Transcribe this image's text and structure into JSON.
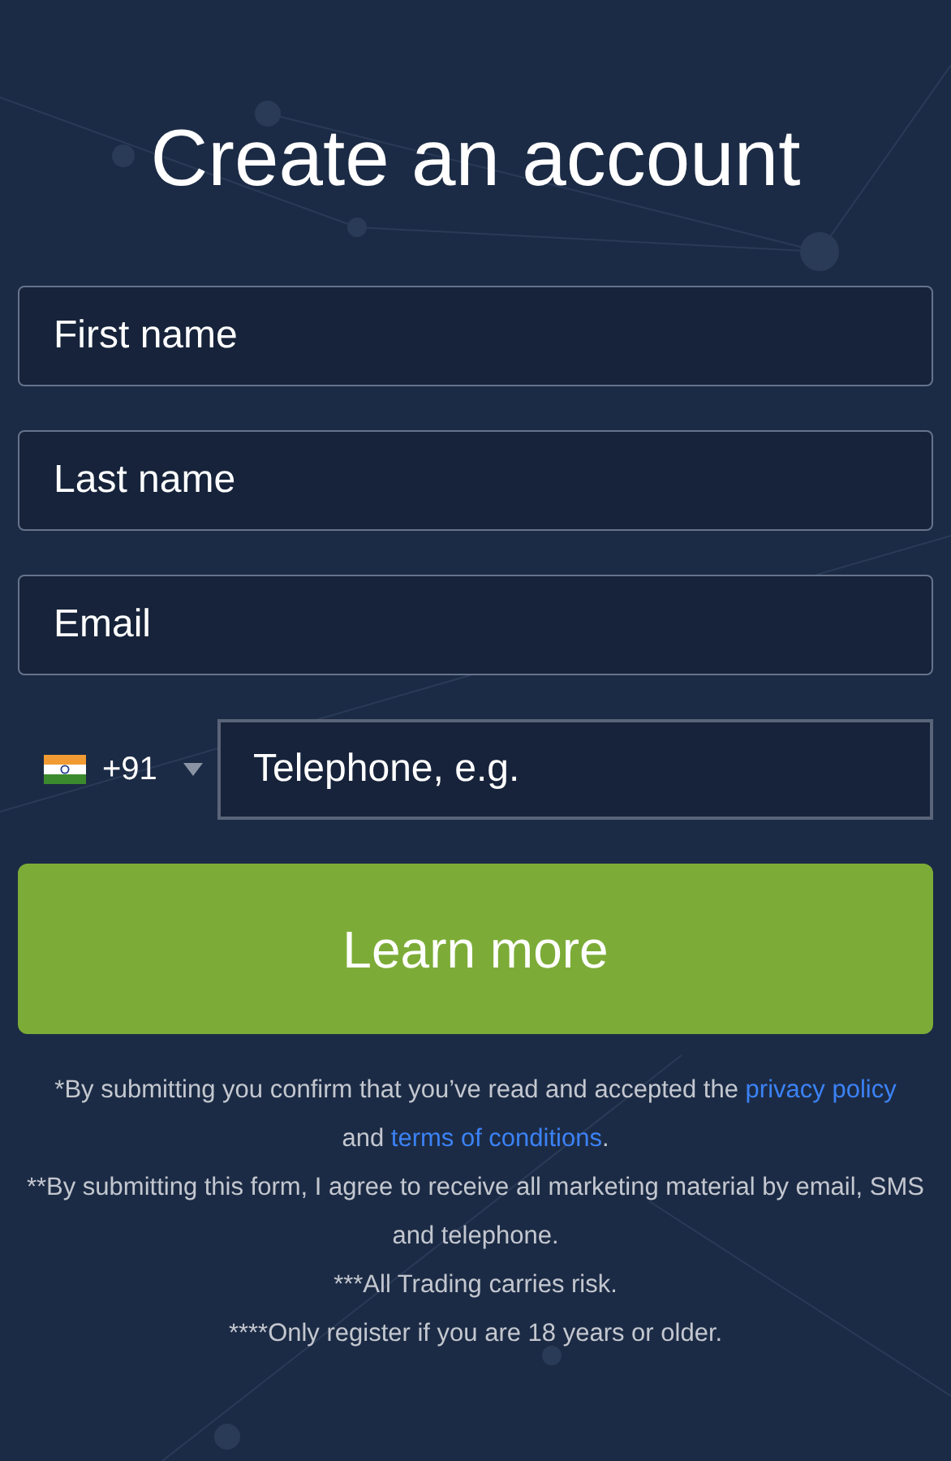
{
  "title": "Create an account",
  "fields": [
    {
      "placeholder": "First name"
    },
    {
      "placeholder": "Last name"
    },
    {
      "placeholder": "Email"
    }
  ],
  "phone": {
    "country_code": "+91",
    "placeholder": "Telephone, e.g."
  },
  "submit_button": "Learn more",
  "consent": {
    "before": "*By submitting you confirm that you’ve read and accepted the",
    "privacy_link": "privacy policy",
    "middle": "and",
    "terms_link": "terms of conditions",
    "after": "."
  },
  "notes": [
    "**By submitting this form, I agree to receive all marketing material by email, SMS and telephone.",
    "***All Trading carries risk.",
    "****Only register if you are 18 years or older."
  ]
}
